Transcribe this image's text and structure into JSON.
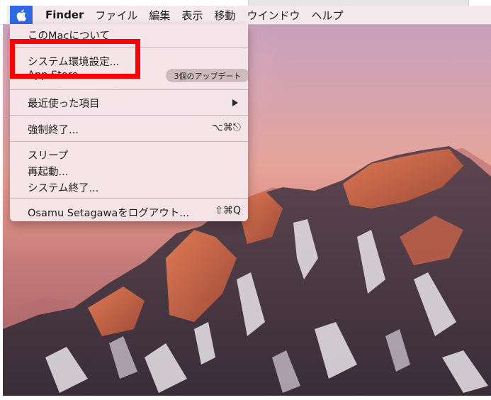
{
  "menubar": {
    "apple_icon": "apple-icon",
    "items": [
      "Finder",
      "ファイル",
      "編集",
      "表示",
      "移動",
      "ウインドウ",
      "ヘルプ"
    ]
  },
  "apple_menu": {
    "about": "このMacについて",
    "system_prefs": "システム環境設定...",
    "app_store": "App Store...",
    "app_store_badge": "3個のアップデート",
    "recent_items": "最近使った項目",
    "force_quit": "強制終了...",
    "force_quit_shortcut": "⌥⌘⎋",
    "sleep": "スリープ",
    "restart": "再起動...",
    "shutdown": "システム終了...",
    "logout": "Osamu Setagawaをログアウト...",
    "logout_shortcut": "⇧⌘Q"
  },
  "colors": {
    "highlight": "#ff0000",
    "apple_menu_active": "#2f6ae0"
  }
}
